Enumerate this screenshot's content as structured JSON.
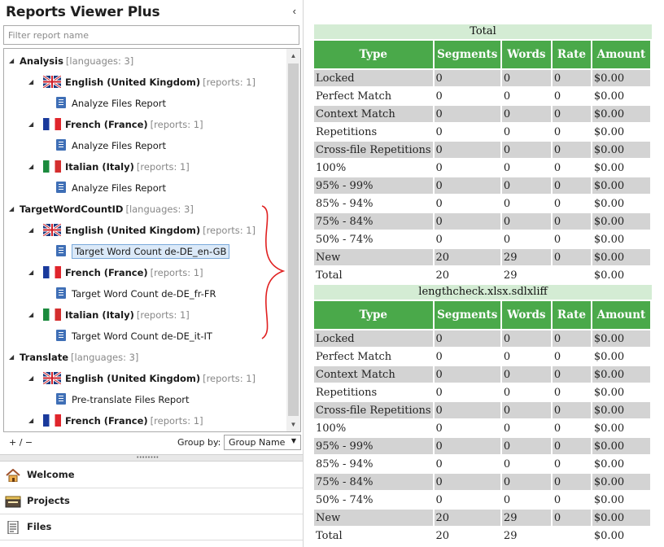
{
  "app": {
    "title": "Reports Viewer Plus",
    "collapse_glyph": "‹"
  },
  "filter": {
    "placeholder": "Filter report name"
  },
  "tree": [
    {
      "level": 0,
      "label": "Analysis",
      "meta": "[languages: 3]",
      "kind": "group"
    },
    {
      "level": 1,
      "label": "English (United Kingdom)",
      "meta": "[reports: 1]",
      "kind": "lang",
      "flag": "uk"
    },
    {
      "level": 2,
      "label": "Analyze Files Report",
      "kind": "report"
    },
    {
      "level": 1,
      "label": "French (France)",
      "meta": "[reports: 1]",
      "kind": "lang",
      "flag": "fr"
    },
    {
      "level": 2,
      "label": "Analyze Files Report",
      "kind": "report"
    },
    {
      "level": 1,
      "label": "Italian (Italy)",
      "meta": "[reports: 1]",
      "kind": "lang",
      "flag": "it"
    },
    {
      "level": 2,
      "label": "Analyze Files Report",
      "kind": "report"
    },
    {
      "level": 0,
      "label": "TargetWordCountID",
      "meta": "[languages: 3]",
      "kind": "group"
    },
    {
      "level": 1,
      "label": "English (United Kingdom)",
      "meta": "[reports: 1]",
      "kind": "lang",
      "flag": "uk"
    },
    {
      "level": 2,
      "label": "Target Word Count de-DE_en-GB",
      "kind": "report",
      "selected": true
    },
    {
      "level": 1,
      "label": "French (France)",
      "meta": "[reports: 1]",
      "kind": "lang",
      "flag": "fr"
    },
    {
      "level": 2,
      "label": "Target Word Count de-DE_fr-FR",
      "kind": "report"
    },
    {
      "level": 1,
      "label": "Italian (Italy)",
      "meta": "[reports: 1]",
      "kind": "lang",
      "flag": "it"
    },
    {
      "level": 2,
      "label": "Target Word Count de-DE_it-IT",
      "kind": "report"
    },
    {
      "level": 0,
      "label": "Translate",
      "meta": "[languages: 3]",
      "kind": "group"
    },
    {
      "level": 1,
      "label": "English (United Kingdom)",
      "meta": "[reports: 1]",
      "kind": "lang",
      "flag": "uk"
    },
    {
      "level": 2,
      "label": "Pre-translate Files Report",
      "kind": "report"
    },
    {
      "level": 1,
      "label": "French (France)",
      "meta": "[reports: 1]",
      "kind": "lang",
      "flag": "fr"
    }
  ],
  "footer": {
    "plus_minus": "+ / −",
    "group_by_label": "Group by:",
    "group_by_value": "Group Name"
  },
  "nav": [
    {
      "label": "Welcome",
      "icon": "home-icon"
    },
    {
      "label": "Projects",
      "icon": "projects-icon"
    },
    {
      "label": "Files",
      "icon": "files-icon"
    }
  ],
  "colors": {
    "header_green": "#4aa94a",
    "section_green": "#d4ecd4",
    "row_gray": "#d3d3d3",
    "annotation_red": "#e02020"
  },
  "report": {
    "columns": [
      "Type",
      "Segments",
      "Words",
      "Rate",
      "Amount"
    ],
    "sections": [
      {
        "title": "Total",
        "rows": [
          [
            "Locked",
            "0",
            "0",
            "0",
            "$0.00"
          ],
          [
            "Perfect Match",
            "0",
            "0",
            "0",
            "$0.00"
          ],
          [
            "Context Match",
            "0",
            "0",
            "0",
            "$0.00"
          ],
          [
            "Repetitions",
            "0",
            "0",
            "0",
            "$0.00"
          ],
          [
            "Cross-file Repetitions",
            "0",
            "0",
            "0",
            "$0.00"
          ],
          [
            "100%",
            "0",
            "0",
            "0",
            "$0.00"
          ],
          [
            "95% - 99%",
            "0",
            "0",
            "0",
            "$0.00"
          ],
          [
            "85% - 94%",
            "0",
            "0",
            "0",
            "$0.00"
          ],
          [
            "75% - 84%",
            "0",
            "0",
            "0",
            "$0.00"
          ],
          [
            "50% - 74%",
            "0",
            "0",
            "0",
            "$0.00"
          ],
          [
            "New",
            "20",
            "29",
            "0",
            "$0.00"
          ],
          [
            "Total",
            "20",
            "29",
            "",
            "$0.00"
          ]
        ]
      },
      {
        "title": "lengthcheck.xlsx.sdlxliff",
        "rows": [
          [
            "Locked",
            "0",
            "0",
            "0",
            "$0.00"
          ],
          [
            "Perfect Match",
            "0",
            "0",
            "0",
            "$0.00"
          ],
          [
            "Context Match",
            "0",
            "0",
            "0",
            "$0.00"
          ],
          [
            "Repetitions",
            "0",
            "0",
            "0",
            "$0.00"
          ],
          [
            "Cross-file Repetitions",
            "0",
            "0",
            "0",
            "$0.00"
          ],
          [
            "100%",
            "0",
            "0",
            "0",
            "$0.00"
          ],
          [
            "95% - 99%",
            "0",
            "0",
            "0",
            "$0.00"
          ],
          [
            "85% - 94%",
            "0",
            "0",
            "0",
            "$0.00"
          ],
          [
            "75% - 84%",
            "0",
            "0",
            "0",
            "$0.00"
          ],
          [
            "50% - 74%",
            "0",
            "0",
            "0",
            "$0.00"
          ],
          [
            "New",
            "20",
            "29",
            "0",
            "$0.00"
          ],
          [
            "Total",
            "20",
            "29",
            "",
            "$0.00"
          ]
        ]
      }
    ]
  }
}
